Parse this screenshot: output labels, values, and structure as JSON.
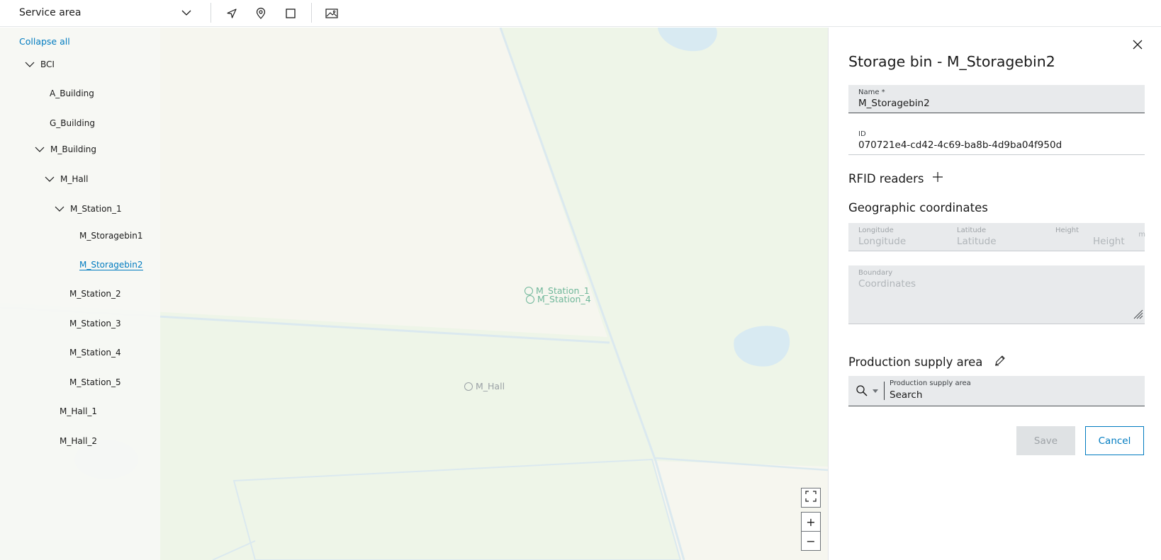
{
  "toolbar": {
    "area_select_value": "Service area",
    "tools": [
      {
        "icon": "navigate-arrow-icon"
      },
      {
        "icon": "location-pin-icon"
      },
      {
        "icon": "rectangle-select-icon"
      },
      {
        "icon": "image-map-icon"
      }
    ]
  },
  "tree": {
    "collapse_all_label": "Collapse all",
    "nodes": [
      {
        "label": "BCI",
        "expanded": true
      },
      {
        "label": "A_Building"
      },
      {
        "label": "G_Building"
      },
      {
        "label": "M_Building",
        "expanded": true
      },
      {
        "label": "M_Hall",
        "expanded": true
      },
      {
        "label": "M_Station_1",
        "expanded": true
      },
      {
        "label": "M_Storagebin1"
      },
      {
        "label": "M_Storagebin2",
        "selected": true
      },
      {
        "label": "M_Station_2"
      },
      {
        "label": "M_Station_3"
      },
      {
        "label": "M_Station_4"
      },
      {
        "label": "M_Station_5"
      },
      {
        "label": "M_Hall_1"
      },
      {
        "label": "M_Hall_2"
      }
    ]
  },
  "map": {
    "pins": [
      {
        "label": "M_Station_1",
        "kind": "station"
      },
      {
        "label": "M_Station_4",
        "kind": "station"
      },
      {
        "label": "M_Hall",
        "kind": "hall"
      }
    ],
    "controls": {
      "fullscreen_icon": "fullscreen-icon",
      "zoom_in": "+",
      "zoom_out": "−"
    }
  },
  "panel": {
    "title": "Storage bin - M_Storagebin2",
    "name": {
      "label": "Name *",
      "value": "M_Storagebin2"
    },
    "id": {
      "label": "ID",
      "value": "070721e4-cd42-4c69-ba8b-4d9ba04f950d"
    },
    "rfid": {
      "heading": "RFID readers"
    },
    "geo": {
      "heading": "Geographic coordinates",
      "longitude": {
        "label": "Longitude",
        "placeholder": "Longitude"
      },
      "latitude": {
        "label": "Latitude",
        "placeholder": "Latitude"
      },
      "height": {
        "label": "Height",
        "placeholder": "Height",
        "unit": "m"
      },
      "boundary": {
        "label": "Boundary",
        "placeholder": "Coordinates"
      }
    },
    "psa": {
      "heading": "Production supply area",
      "field_label": "Production supply area",
      "field_value": "Search"
    },
    "save_label": "Save",
    "cancel_label": "Cancel"
  },
  "colors": {
    "accent": "#007bc0",
    "map_green": "#eef5e8",
    "map_beige": "#f6f6ef",
    "water": "#d8eaf2"
  }
}
